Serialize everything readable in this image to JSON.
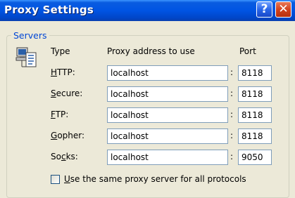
{
  "window": {
    "title": "Proxy Settings",
    "help_label": "?",
    "close_label": "✕"
  },
  "servers": {
    "group_label": "Servers",
    "col_type": "Type",
    "col_address": "Proxy address to use",
    "col_port": "Port",
    "separator": ":",
    "rows": [
      {
        "mnemonic": "H",
        "label_rest": "TTP:",
        "address": "localhost",
        "port": "8118"
      },
      {
        "mnemonic": "S",
        "label_rest": "ecure:",
        "address": "localhost",
        "port": "8118"
      },
      {
        "mnemonic": "F",
        "label_rest": "TP:",
        "address": "localhost",
        "port": "8118"
      },
      {
        "mnemonic": "G",
        "label_rest": "opher:",
        "address": "localhost",
        "port": "8118"
      },
      {
        "mnemonic_pre": "So",
        "mnemonic": "c",
        "label_rest": "ks:",
        "address": "localhost",
        "port": "9050"
      }
    ],
    "same_proxy": {
      "mnemonic": "U",
      "label_rest": "se the same proxy server for all protocols",
      "checked": false
    }
  },
  "icons": {
    "servers": "network-computers-icon"
  }
}
